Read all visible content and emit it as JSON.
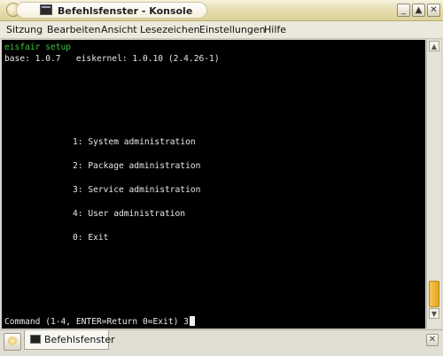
{
  "window": {
    "title": "Befehlsfenster - Konsole",
    "controls": {
      "minimize": "_",
      "maximize": "▲",
      "close": "✕"
    }
  },
  "menubar": {
    "items": [
      "Sitzung",
      "Bearbeiten",
      "Ansicht",
      "Lesezeichen",
      "Einstellungen",
      "Hilfe"
    ]
  },
  "terminal": {
    "header_title": "eisfair setup",
    "header_version": "base: 1.0.7   eiskernel: 1.0.10 (2.4.26-1)",
    "menu": [
      "1: System administration",
      "2: Package administration",
      "3: Service administration",
      "4: User administration",
      "0: Exit"
    ],
    "prompt": "Command (1-4, ENTER=Return 0=Exit)",
    "input": "3"
  },
  "scrollbar": {
    "position_fraction": 0.9
  },
  "tabbar": {
    "tabs": [
      {
        "label": "Befehlsfenster"
      }
    ]
  },
  "colors": {
    "terminal_bg": "#000000",
    "terminal_fg": "#e8e8e8",
    "header_green": "#3dc43d",
    "scroll_thumb": "#e7a522"
  }
}
